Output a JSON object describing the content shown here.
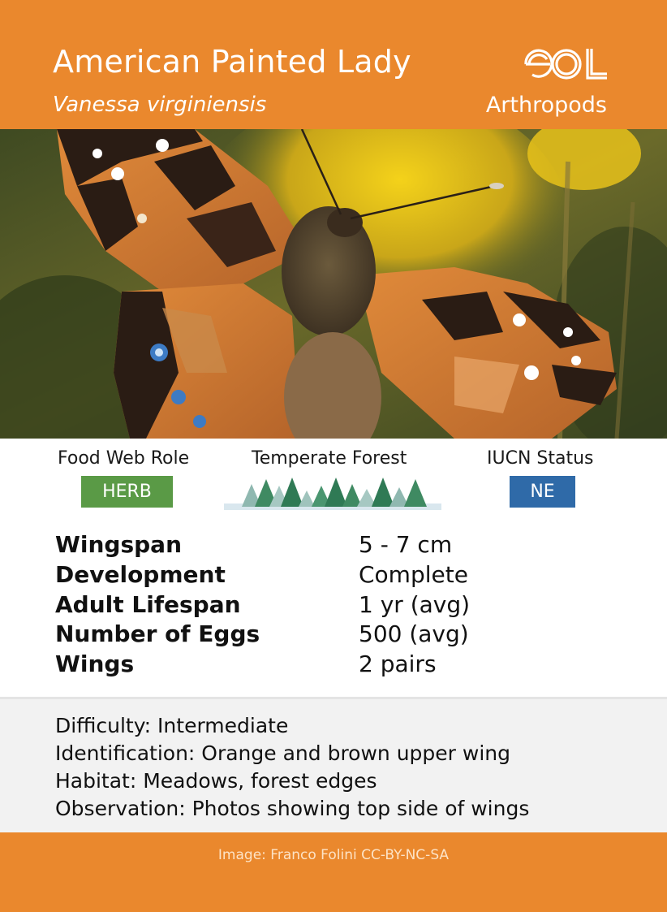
{
  "header": {
    "common_name": "American Painted Lady",
    "scientific_name": "Vanessa virginiensis",
    "group": "Arthropods",
    "logo_text": "eol"
  },
  "photo": {
    "subject": "butterfly-photo"
  },
  "roles": {
    "food_web_label": "Food Web Role",
    "food_web_value": "HERB",
    "habitat_label": "Temperate Forest",
    "iucn_label": "IUCN Status",
    "iucn_value": "NE"
  },
  "facts": [
    {
      "label": "Wingspan",
      "value": "5 - 7 cm"
    },
    {
      "label": "Development",
      "value": "Complete"
    },
    {
      "label": "Adult Lifespan",
      "value": "1 yr (avg)"
    },
    {
      "label": "Number of Eggs",
      "value": "500 (avg)"
    },
    {
      "label": "Wings",
      "value": "2 pairs"
    }
  ],
  "notes": [
    "Difficulty: Intermediate",
    "Identification: Orange and brown upper wing",
    "Habitat: Meadows, forest edges",
    "Observation: Photos showing top side of wings"
  ],
  "footer": {
    "credit": "Image: Franco Folini CC-BY-NC-SA"
  },
  "colors": {
    "brand_orange": "#ea882d",
    "herb_green": "#5a9a46",
    "iucn_blue": "#2f6aa8",
    "notes_bg": "#f2f2f2"
  }
}
